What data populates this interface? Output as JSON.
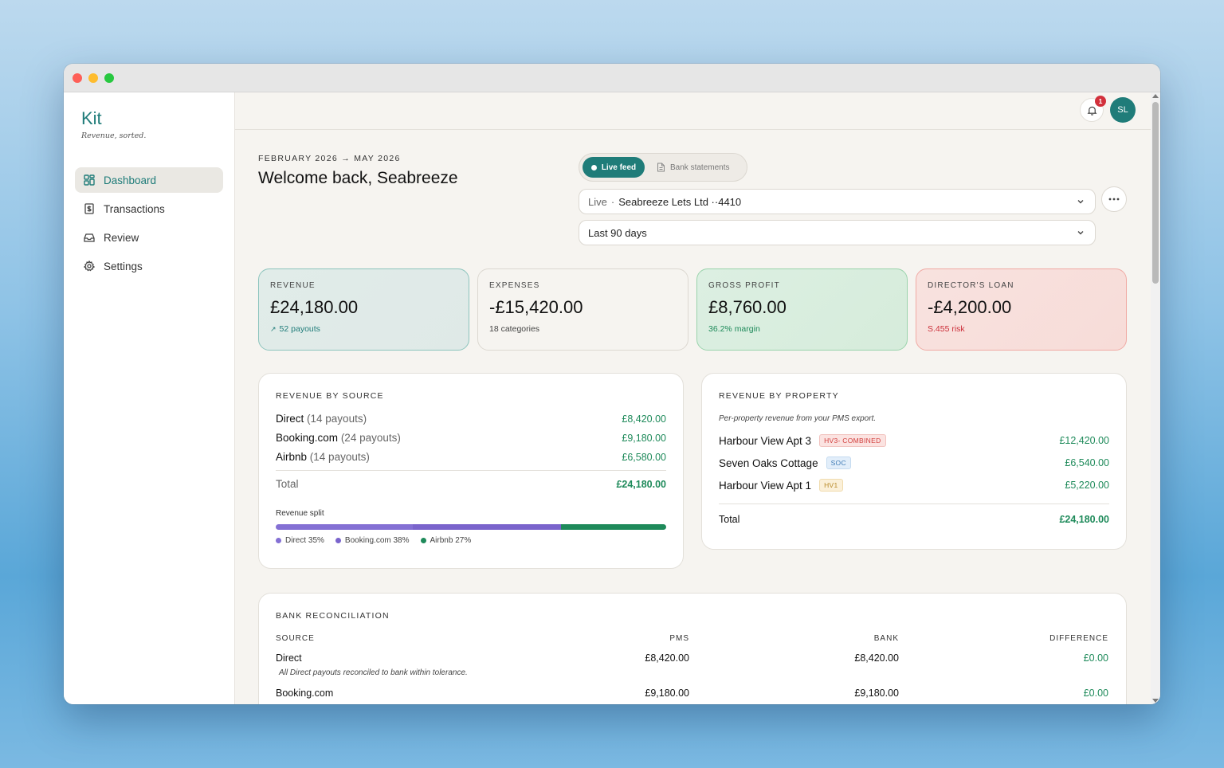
{
  "brand": {
    "name": "Kit",
    "tagline": "Revenue, sorted."
  },
  "nav": [
    {
      "label": "Dashboard",
      "icon": "dashboard-icon",
      "active": true
    },
    {
      "label": "Transactions",
      "icon": "receipt-icon"
    },
    {
      "label": "Review",
      "icon": "inbox-icon"
    },
    {
      "label": "Settings",
      "icon": "gear-icon"
    }
  ],
  "topbar": {
    "notifications": "1",
    "avatar": "SL"
  },
  "header": {
    "date_range": "FEBRUARY 2026 → MAY 2026",
    "welcome": "Welcome back, Seabreeze"
  },
  "toggle": {
    "live": "Live feed",
    "bank": "Bank statements"
  },
  "account_select": {
    "prefix": "Live",
    "separator": "·",
    "value": "Seabreeze Lets Ltd ··4410"
  },
  "period_select": {
    "value": "Last 90 days"
  },
  "kpis": {
    "revenue": {
      "label": "REVENUE",
      "value": "£24,180.00",
      "arrow": "↗",
      "sub": "52 payouts"
    },
    "expenses": {
      "label": "EXPENSES",
      "value": "-£15,420.00",
      "sub": "18 categories"
    },
    "profit": {
      "label": "GROSS PROFIT",
      "value": "£8,760.00",
      "sub": "36.2% margin"
    },
    "loan": {
      "label": "DIRECTOR'S LOAN",
      "value": "-£4,200.00",
      "sub": "S.455 risk"
    }
  },
  "revenue_by_source": {
    "title": "REVENUE BY SOURCE",
    "rows": [
      {
        "name": "Direct",
        "count": "(14 payouts)",
        "amount": "£8,420.00"
      },
      {
        "name": "Booking.com",
        "count": "(24 payouts)",
        "amount": "£9,180.00"
      },
      {
        "name": "Airbnb",
        "count": "(14 payouts)",
        "amount": "£6,580.00"
      }
    ],
    "total_label": "Total",
    "total": "£24,180.00",
    "split_label": "Revenue split",
    "split": [
      {
        "name": "Direct 35%",
        "share": 0.35,
        "color": "#8470d4"
      },
      {
        "name": "Booking.com 38%",
        "share": 0.38,
        "color": "#7a64cc"
      },
      {
        "name": "Airbnb 27%",
        "share": 0.27,
        "color": "#1e8a5a"
      }
    ]
  },
  "revenue_by_property": {
    "title": "REVENUE BY PROPERTY",
    "note": "Per-property revenue from your PMS export.",
    "rows": [
      {
        "name": "Harbour View Apt 3",
        "tag": "HV3- COMBINED",
        "amount": "£12,420.00"
      },
      {
        "name": "Seven Oaks Cottage",
        "tag": "SOC",
        "amount": "£6,540.00"
      },
      {
        "name": "Harbour View Apt 1",
        "tag": "HV1",
        "amount": "£5,220.00"
      }
    ],
    "total_label": "Total",
    "total": "£24,180.00"
  },
  "reconciliation": {
    "title": "BANK RECONCILIATION",
    "columns": [
      "SOURCE",
      "PMS",
      "BANK",
      "DIFFERENCE"
    ],
    "rows": [
      {
        "source": "Direct",
        "pms": "£8,420.00",
        "bank": "£8,420.00",
        "diff": "£0.00",
        "note": "All Direct payouts reconciled to bank within tolerance."
      },
      {
        "source": "Booking.com",
        "pms": "£9,180.00",
        "bank": "£9,180.00",
        "diff": "£0.00"
      }
    ]
  }
}
